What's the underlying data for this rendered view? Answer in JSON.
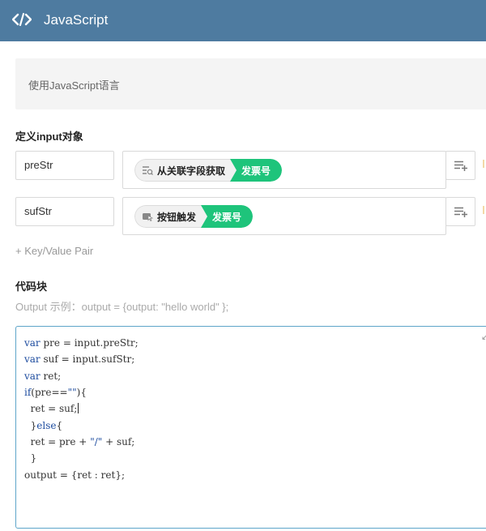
{
  "header": {
    "title": "JavaScript",
    "icon": "code-icon"
  },
  "description": "使用JavaScript语言",
  "inputs_section": {
    "label": "定义input对象"
  },
  "pairs": [
    {
      "key": "preStr",
      "source_label": "从关联字段获取",
      "source_icon": "field-link-icon",
      "value": "发票号"
    },
    {
      "key": "sufStr",
      "source_label": "按钮触发",
      "source_icon": "button-trigger-icon",
      "value": "发票号"
    }
  ],
  "add_pair_label": "+ Key/Value Pair",
  "code_section": {
    "label": "代码块",
    "example": "Output 示例：output = {output: \"hello world\" };"
  },
  "code_lines": [
    "var pre = input.preStr;",
    "var suf = input.sufStr;",
    "var ret;",
    "if(pre==\"\"){",
    "  ret = suf;",
    "  }else{",
    "  ret = pre + \"/\" + suf;",
    "  }",
    "output = {ret : ret};"
  ],
  "colors": {
    "header_bg": "#4e7ba0",
    "tag_value_bg": "#1ec47b",
    "editor_border": "#5ea5c9",
    "keyword": "#1b4a9e"
  }
}
